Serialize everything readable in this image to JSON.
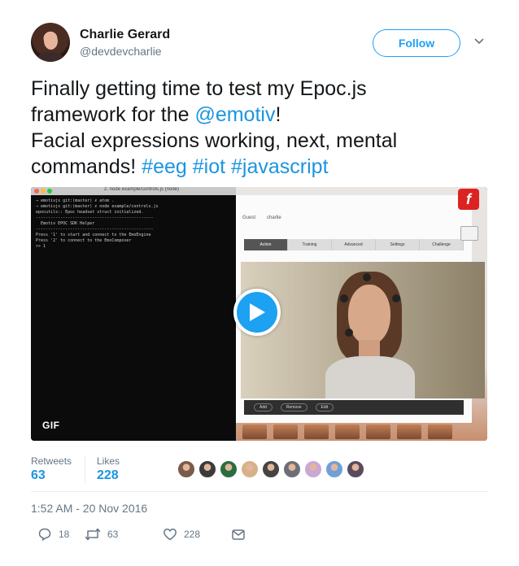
{
  "author": {
    "name": "Charlie Gerard",
    "handle": "@devdevcharlie"
  },
  "follow_label": "Follow",
  "text": {
    "line1": "Finally getting time to test my Epoc.js",
    "line2_prefix": "framework for the ",
    "mention": "@emotiv",
    "line2_suffix": "!",
    "line3": "Facial expressions working, next, mental",
    "line4_prefix": "commands! ",
    "hashtags": [
      "#eeg",
      "#iot",
      "#javascript"
    ]
  },
  "media": {
    "badge": "GIF",
    "terminal_title": "2. node example/controls.js (node)",
    "terminal_lines": [
      "→ emotivjs git:(master) ✗ atom .",
      "→ emotivjs git:(master) ✗ node example/controls.js",
      "epocutils:: Epoc headset struct initialized.",
      "------------------------------------------------",
      "  Emotiv EPOC SDK Helper",
      "------------------------------------------------",
      "Press '1' to start and connect to the EmoEngine",
      "Press '2' to connect to the EmoComposer",
      ">> 1"
    ],
    "emotiv_tabs": [
      "Action",
      "Training",
      "Advanced",
      "Settings",
      "Challenge"
    ],
    "emotiv_user_guest": "Guest",
    "emotiv_user_charlie": "charlie",
    "emotiv_buttons": [
      "Add",
      "Remove",
      "Edit"
    ],
    "app_letter": "f"
  },
  "stats": {
    "retweets_label": "Retweets",
    "retweets_value": "63",
    "likes_label": "Likes",
    "likes_value": "228"
  },
  "liker_colors": [
    "#7a5a48",
    "#3b3b3b",
    "#2a6e3f",
    "#d7b18a",
    "#444444",
    "#6c6f78",
    "#c9a7d6",
    "#6fa1d8",
    "#5a4a5e"
  ],
  "timestamp": "1:52 AM - 20 Nov 2016",
  "actions": {
    "replies": "18",
    "retweets": "63",
    "likes": "228"
  },
  "colors": {
    "accent": "#1da1f2",
    "link": "#1b95e0",
    "muted": "#657786"
  }
}
